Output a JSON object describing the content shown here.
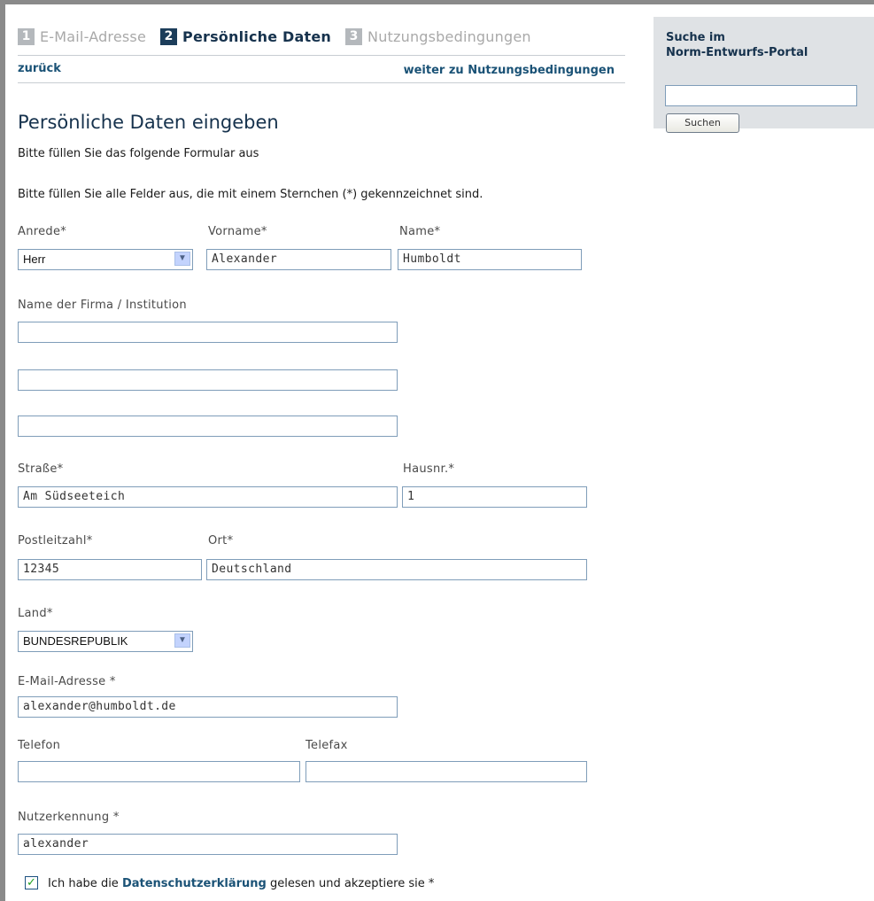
{
  "steps": [
    {
      "number": "1",
      "label": "E-Mail-Adresse"
    },
    {
      "number": "2",
      "label": "Persönliche Daten"
    },
    {
      "number": "3",
      "label": "Nutzungsbedingungen"
    }
  ],
  "nav": {
    "back": "zurück",
    "next": "weiter zu Nutzungsbedingungen"
  },
  "page": {
    "heading": "Persönliche Daten eingeben",
    "intro": "Bitte füllen Sie das folgende Formular aus",
    "required_hint": "Bitte füllen Sie alle Felder aus, die mit einem Sternchen (*) gekennzeichnet sind."
  },
  "form": {
    "salutation": {
      "label": "Anrede*",
      "value": "Herr"
    },
    "first_name": {
      "label": "Vorname*",
      "value": "Alexander"
    },
    "last_name": {
      "label": "Name*",
      "value": "Humboldt"
    },
    "company": {
      "label": "Name der Firma / Institution",
      "line1": "",
      "line2": "",
      "line3": ""
    },
    "street": {
      "label": "Straße*",
      "value": "Am Südseeteich"
    },
    "house_number": {
      "label": "Hausnr.*",
      "value": "1"
    },
    "postal_code": {
      "label": "Postleitzahl*",
      "value": "12345"
    },
    "city": {
      "label": "Ort*",
      "value": "Deutschland"
    },
    "country": {
      "label": "Land*",
      "value": "BUNDESREPUBLIK"
    },
    "email": {
      "label": "E-Mail-Adresse *",
      "value": "alexander@humboldt.de"
    },
    "phone": {
      "label": "Telefon",
      "value": ""
    },
    "fax": {
      "label": "Telefax",
      "value": ""
    },
    "username": {
      "label": "Nutzerkennung *",
      "value": "alexander"
    },
    "privacy": {
      "checked": true,
      "text_before": "Ich habe die",
      "link": "Datenschutzerklärung",
      "text_after": "gelesen und akzeptiere sie *"
    }
  },
  "search": {
    "title_line1": "Suche im",
    "title_line2": "Norm-Entwurfs-Portal",
    "value": "",
    "button": "Suchen"
  },
  "icons": {
    "dropdown": "chevron-down-icon",
    "checkbox": "checkmark-icon"
  },
  "colors": {
    "accent": "#16324d",
    "link": "#1a5276",
    "step_inactive": "#b4b8bc",
    "search_panel": "#dfe2e5"
  }
}
